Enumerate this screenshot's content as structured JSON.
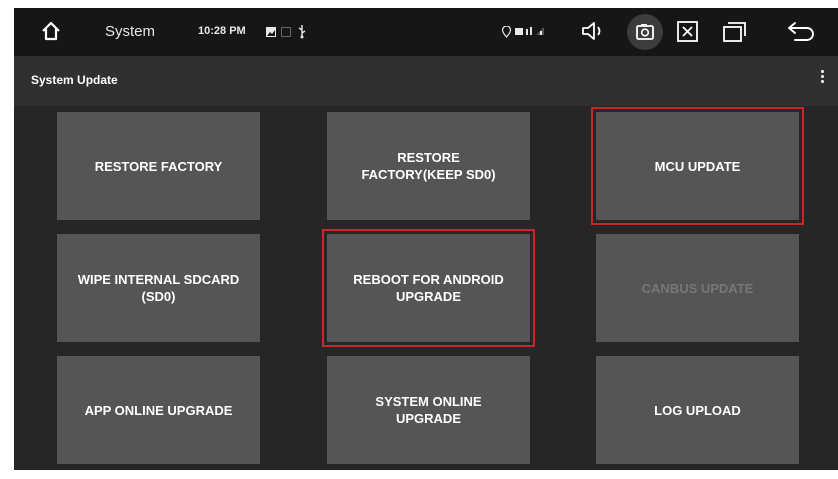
{
  "statusbar": {
    "home_icon": "home-icon",
    "app_name": "System",
    "time": "10:28 PM",
    "icons": [
      "image-icon",
      "sd-card-icon",
      "usb-icon",
      "location-icon",
      "signal-icon",
      "volume-icon",
      "camera-icon",
      "close-icon",
      "recents-icon",
      "back-icon"
    ]
  },
  "appbar": {
    "title": "System Update",
    "menu_icon": "more-vert-icon"
  },
  "tiles": [
    {
      "label": "RESTORE FACTORY",
      "enabled": true,
      "highlighted": false
    },
    {
      "label": "RESTORE FACTORY(KEEP SD0)",
      "enabled": true,
      "highlighted": false
    },
    {
      "label": "MCU UPDATE",
      "enabled": true,
      "highlighted": true
    },
    {
      "label": "WIPE INTERNAL SDCARD (SD0)",
      "enabled": true,
      "highlighted": false
    },
    {
      "label": "REBOOT FOR ANDROID UPGRADE",
      "enabled": true,
      "highlighted": true
    },
    {
      "label": "CANBUS UPDATE",
      "enabled": false,
      "highlighted": false
    },
    {
      "label": "APP ONLINE UPGRADE",
      "enabled": true,
      "highlighted": false
    },
    {
      "label": "SYSTEM ONLINE UPGRADE",
      "enabled": true,
      "highlighted": false
    },
    {
      "label": "LOG UPLOAD",
      "enabled": true,
      "highlighted": false
    }
  ],
  "colors": {
    "background": "#262626",
    "statusbar": "#161616",
    "appbar": "#303030",
    "tile": "#555555",
    "highlight": "#c62828",
    "disabled_text": "#777777"
  }
}
